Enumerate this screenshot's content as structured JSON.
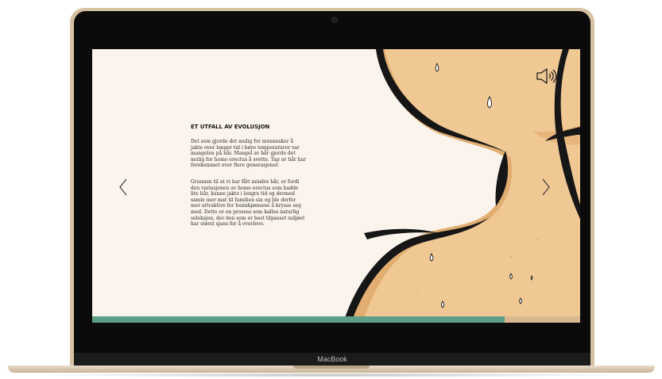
{
  "device": {
    "brand_label": "MacBook"
  },
  "article": {
    "heading": "ET UTFALL AV EVOLUSJON",
    "paragraph_1": "Det som gjorde det mulig for mennesker å jakte over lenger tid i høye temperaturer var mangelen på hår. Mangel av hår gjorde det mulig for homo erectus å svette. Tap av hår har forekommet over flere generasjoner.",
    "paragraph_2": "Grunnen til at vi har fått mindre hår, er fordi den variasjonen av homo erectus som hadde lite hår, kunne jakte i lengre tid og dermed samle mer mat til familien sin og ble derfor mer attraktive for hunnkjønnene å krysse seg med. Dette er en prosess som kalles naturlig seleksjon, der den som er best tilpasset miljøet har størst sjans for å overleve."
  },
  "controls": {
    "prev_icon": "chevron-left-icon",
    "next_icon": "chevron-right-icon",
    "sound_icon": "speaker-icon"
  },
  "progress": {
    "fraction": 0.845
  },
  "colors": {
    "page_background": "#fbf4ec",
    "skin": "#f0c894",
    "skin_shadow": "#e2ad70",
    "ink": "#161616",
    "progress_fill": "#5e9f8a",
    "progress_track": "#d9b88f"
  }
}
